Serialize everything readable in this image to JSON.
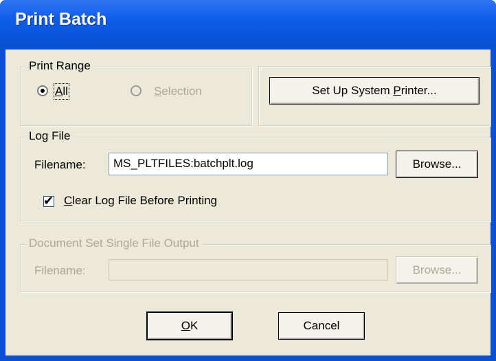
{
  "window": {
    "title": "Print Batch"
  },
  "print_range": {
    "legend": "Print Range",
    "all_label_mnemonic": "A",
    "all_label_rest": "ll",
    "selection_label_mnemonic": "S",
    "selection_label_rest": "election",
    "selected": "All",
    "setup_printer_prefix": "Set Up System ",
    "setup_printer_mnemonic": "P",
    "setup_printer_suffix": "rinter..."
  },
  "log_file": {
    "legend": "Log File",
    "filename_label": "Filename:",
    "filename_value": "MS_PLTFILES:batchplt.log",
    "browse_label": "Browse...",
    "clear_checked": true,
    "clear_mnemonic": "C",
    "clear_rest": "lear Log File Before Printing"
  },
  "doc_set": {
    "legend": "Document Set Single File Output",
    "filename_label": "Filename:",
    "filename_value": "",
    "browse_label": "Browse..."
  },
  "buttons": {
    "ok_mnemonic": "O",
    "ok_rest": "K",
    "cancel_label": "Cancel"
  },
  "colors": {
    "titlebar": "#0a53db",
    "dialog_face": "#ece9d8",
    "disabled_text": "#aca899"
  }
}
